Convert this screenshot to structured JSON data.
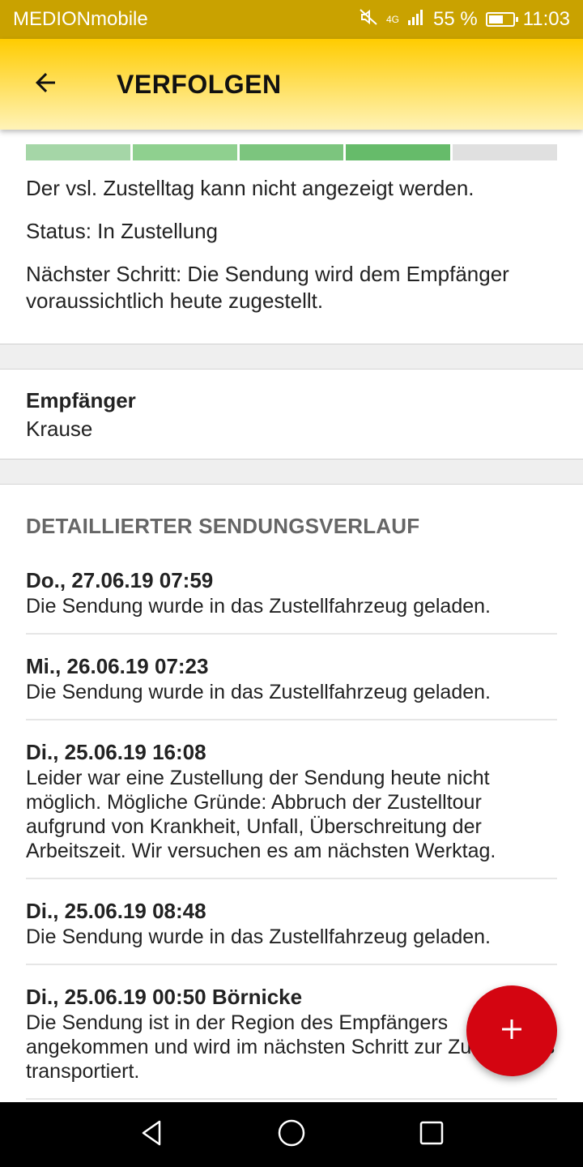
{
  "status_bar": {
    "carrier": "MEDIONmobile",
    "network": "4G",
    "battery": "55 %",
    "time": "11:03"
  },
  "app_bar": {
    "title": "VERFOLGEN",
    "back_icon": "arrow-back-icon"
  },
  "progress": {
    "completed_steps": 4,
    "total_steps": 5,
    "colors": [
      "#a5d6a7",
      "#8fd08f",
      "#7cc57e",
      "#66bb6a",
      "#e0e0e0"
    ]
  },
  "status": {
    "delivery_day": "Der vsl. Zustelltag kann nicht angezeigt werden.",
    "status_line": "Status: In Zustellung",
    "next_step": "Nächster Schritt: Die Sendung wird dem Empfänger voraussichtlich heute zugestellt."
  },
  "recipient": {
    "label": "Empfänger",
    "name": "Krause"
  },
  "history": {
    "title": "DETAILLIERTER SENDUNGSVERLAUF",
    "events": [
      {
        "date": "Do., 27.06.19 07:59",
        "description": "Die Sendung wurde in das Zustellfahrzeug geladen."
      },
      {
        "date": "Mi., 26.06.19 07:23",
        "description": "Die Sendung wurde in das Zustellfahrzeug geladen."
      },
      {
        "date": "Di., 25.06.19 16:08",
        "description": "Leider war eine Zustellung der Sendung heute nicht möglich. Mögliche Gründe: Abbruch der Zustelltour aufgrund von Krankheit, Unfall, Überschreitung der Arbeitszeit. Wir versuchen es am nächsten Werktag."
      },
      {
        "date": "Di., 25.06.19 08:48",
        "description": "Die Sendung wurde in das Zustellfahrzeug geladen."
      },
      {
        "date": "Di., 25.06.19 00:50 Börnicke",
        "description": "Die Sendung ist in der Region des Empfängers angekommen und wird im nächsten Schritt zur Zustellbasis transportiert."
      }
    ]
  },
  "fab": {
    "icon": "plus-icon",
    "color": "#d40511"
  },
  "nav": {
    "back": "nav-back-icon",
    "home": "nav-home-icon",
    "recents": "nav-recents-icon"
  }
}
